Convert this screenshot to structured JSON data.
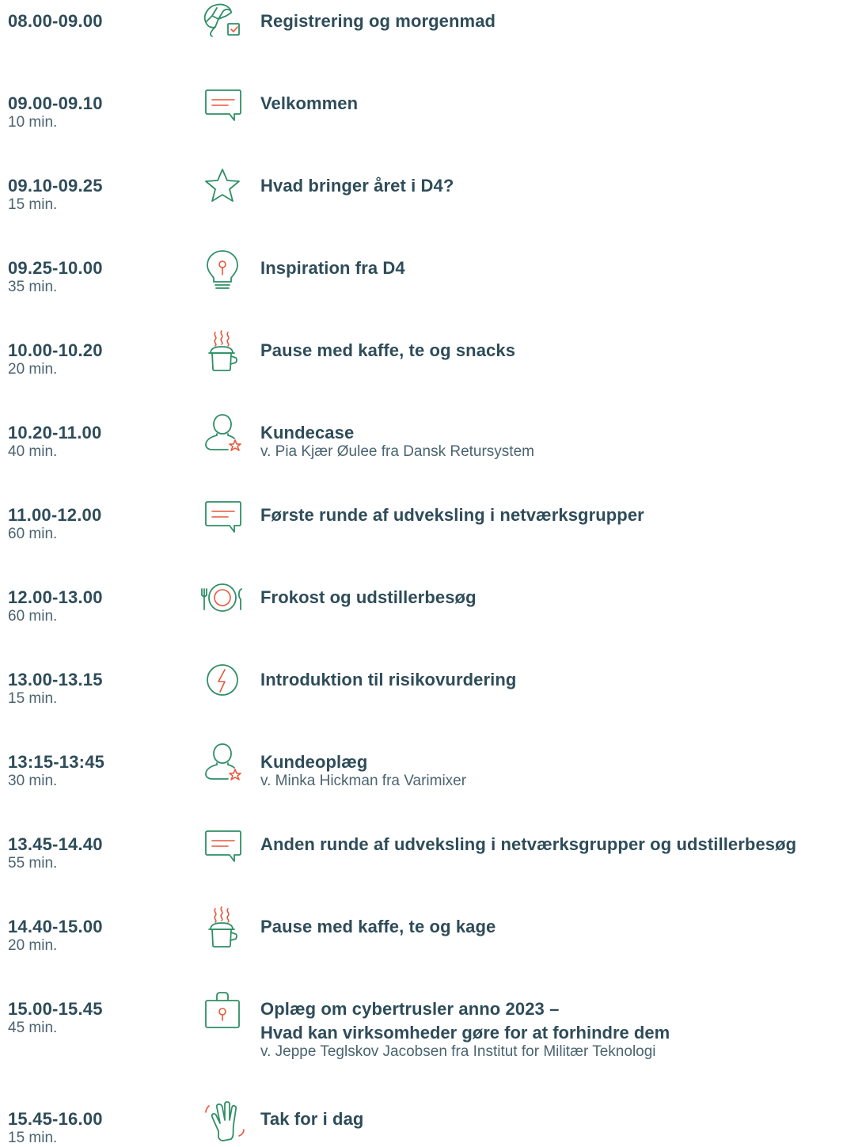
{
  "agenda": [
    {
      "time": "08.00-09.00",
      "duration": "",
      "icon": "croissant-icon",
      "title": "Registrering og morgenmad",
      "title2": "",
      "subtitle": ""
    },
    {
      "time": "09.00-09.10",
      "duration": "10 min.",
      "icon": "speech-bubble-icon",
      "title": "Velkommen",
      "title2": "",
      "subtitle": ""
    },
    {
      "time": "09.10-09.25",
      "duration": "15 min.",
      "icon": "star-icon",
      "title": "Hvad bringer året i D4?",
      "title2": "",
      "subtitle": ""
    },
    {
      "time": "09.25-10.00",
      "duration": "35 min.",
      "icon": "lightbulb-icon",
      "title": "Inspiration fra D4",
      "title2": "",
      "subtitle": ""
    },
    {
      "time": "10.00-10.20",
      "duration": "20 min.",
      "icon": "coffee-cup-icon",
      "title": "Pause med kaffe, te og snacks",
      "title2": "",
      "subtitle": ""
    },
    {
      "time": "10.20-11.00",
      "duration": "40 min.",
      "icon": "person-star-icon",
      "title": "Kundecase",
      "title2": "",
      "subtitle": "v. Pia Kjær Øulee fra Dansk Retursystem"
    },
    {
      "time": "11.00-12.00",
      "duration": "60 min.",
      "icon": "speech-bubble-icon",
      "title": "Første runde af udveksling i netværksgrupper",
      "title2": "",
      "subtitle": ""
    },
    {
      "time": "12.00-13.00",
      "duration": "60 min.",
      "icon": "plate-cutlery-icon",
      "title": "Frokost og udstillerbesøg",
      "title2": "",
      "subtitle": ""
    },
    {
      "time": "13.00-13.15",
      "duration": "15 min.",
      "icon": "lightning-icon",
      "title": "Introduktion til risikovurdering",
      "title2": "",
      "subtitle": ""
    },
    {
      "time": "13:15-13:45",
      "duration": "30 min.",
      "icon": "person-star-icon",
      "title": "Kundeoplæg",
      "title2": "",
      "subtitle": "v. Minka Hickman fra Varimixer"
    },
    {
      "time": "13.45-14.40",
      "duration": "55 min.",
      "icon": "speech-bubble-icon",
      "title": "Anden runde af udveksling i netværksgrupper og udstillerbesøg",
      "title2": "",
      "subtitle": ""
    },
    {
      "time": "14.40-15.00",
      "duration": "20 min.",
      "icon": "coffee-cup-icon",
      "title": "Pause med kaffe, te og kage",
      "title2": "",
      "subtitle": ""
    },
    {
      "time": "15.00-15.45",
      "duration": "45 min.",
      "icon": "padlock-icon",
      "title": "Oplæg om cybertrusler anno 2023 –",
      "title2": "Hvad kan virksomheder gøre for at forhindre dem",
      "subtitle": "v. Jeppe Teglskov Jacobsen fra Institut for Militær Teknologi"
    },
    {
      "time": "15.45-16.00",
      "duration": "15 min.",
      "icon": "waving-hand-icon",
      "title": "Tak for i dag",
      "title2": "",
      "subtitle": ""
    }
  ],
  "colors": {
    "text": "#2e4c59",
    "icon_green": "#2f8f66",
    "icon_accent": "#e8573c"
  }
}
